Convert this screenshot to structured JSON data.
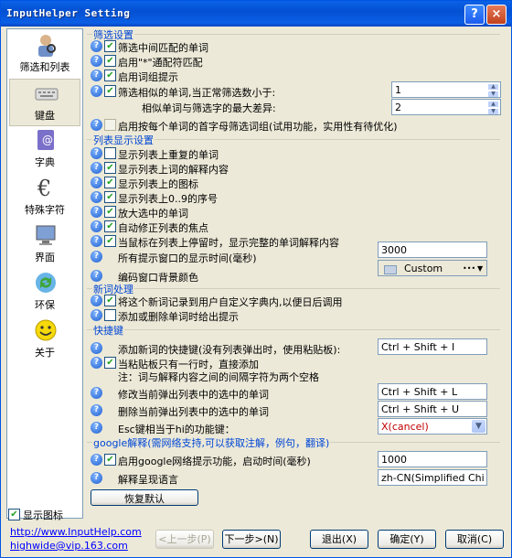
{
  "window": {
    "title": "InputHelper Setting",
    "help": "?",
    "close": "×"
  },
  "sidebar": {
    "items": [
      {
        "label": "筛选和列表"
      },
      {
        "label": "键盘"
      },
      {
        "label": "字典"
      },
      {
        "label": "特殊字符"
      },
      {
        "label": "界面"
      },
      {
        "label": "环保"
      },
      {
        "label": "关于"
      }
    ],
    "show_icon_label": "显示图标"
  },
  "filter": {
    "title": "筛选设置",
    "opts": [
      "筛选中间匹配的单词",
      "启用\"*\"通配符匹配",
      "启用词组提示",
      "筛选相似的单词,当正常筛选数小于:",
      "相似单词与筛选字的最大差异:",
      "启用按每个单词的首字母筛选词组(试用功能，实用性有待优化)"
    ],
    "min_count": "1",
    "max_diff": "2"
  },
  "list": {
    "title": "列表显示设置",
    "opts": [
      "显示列表上重复的单词",
      "显示列表上词的解释内容",
      "显示列表上的图标",
      "显示列表上0..9的序号",
      "放大选中的单词",
      "自动修正列表的焦点",
      "当鼠标在列表上停留时，显示完整的单词解释内容",
      "所有提示窗口的显示时间(毫秒)",
      "编码窗口背景颜色"
    ],
    "display_time": "3000",
    "bg_color": "Custom",
    "more": "•••"
  },
  "newword": {
    "title": "新词处理",
    "opts": [
      "将这个新词记录到用户自定义字典内,以便日后调用",
      "添加或删除单词时给出提示"
    ]
  },
  "hotkey": {
    "title": "快捷键",
    "opts": [
      "添加新词的快捷键(没有列表弹出时，使用粘贴板):",
      "当粘贴板只有一行时，直接添加",
      "注：词与解释内容之间的间隔字符为两个空格",
      "修改当前弹出列表中的选中的单词",
      "删除当前弹出列表中的选中的单词",
      "Esc键相当于hi的功能键："
    ],
    "add_key": "Ctrl + Shift + I",
    "edit_key": "Ctrl + Shift + L",
    "del_key": "Ctrl + Shift + U",
    "esc_func": "X(cancel)"
  },
  "google": {
    "title": "google解释(需网络支持,可以获取注解，例句，翻译)",
    "opts": [
      "启用google网络提示功能，启动时间(毫秒)",
      "解释呈现语言"
    ],
    "time": "1000",
    "lang": "zh-CN(Simplified Chi"
  },
  "buttons": {
    "restore": "恢复默认",
    "prev": "<上一步(P)",
    "next": "下一步>(N)",
    "exit": "退出(X)",
    "ok": "确定(Y)",
    "cancel": "取消(C)"
  },
  "links": {
    "site": "http://www.InputHelp.com",
    "email": "highwide@vip.163.com"
  },
  "colors": {
    "accent": "#0046d5",
    "title_bar": "#0a5fe5",
    "window_bg": "#ece9d8"
  }
}
